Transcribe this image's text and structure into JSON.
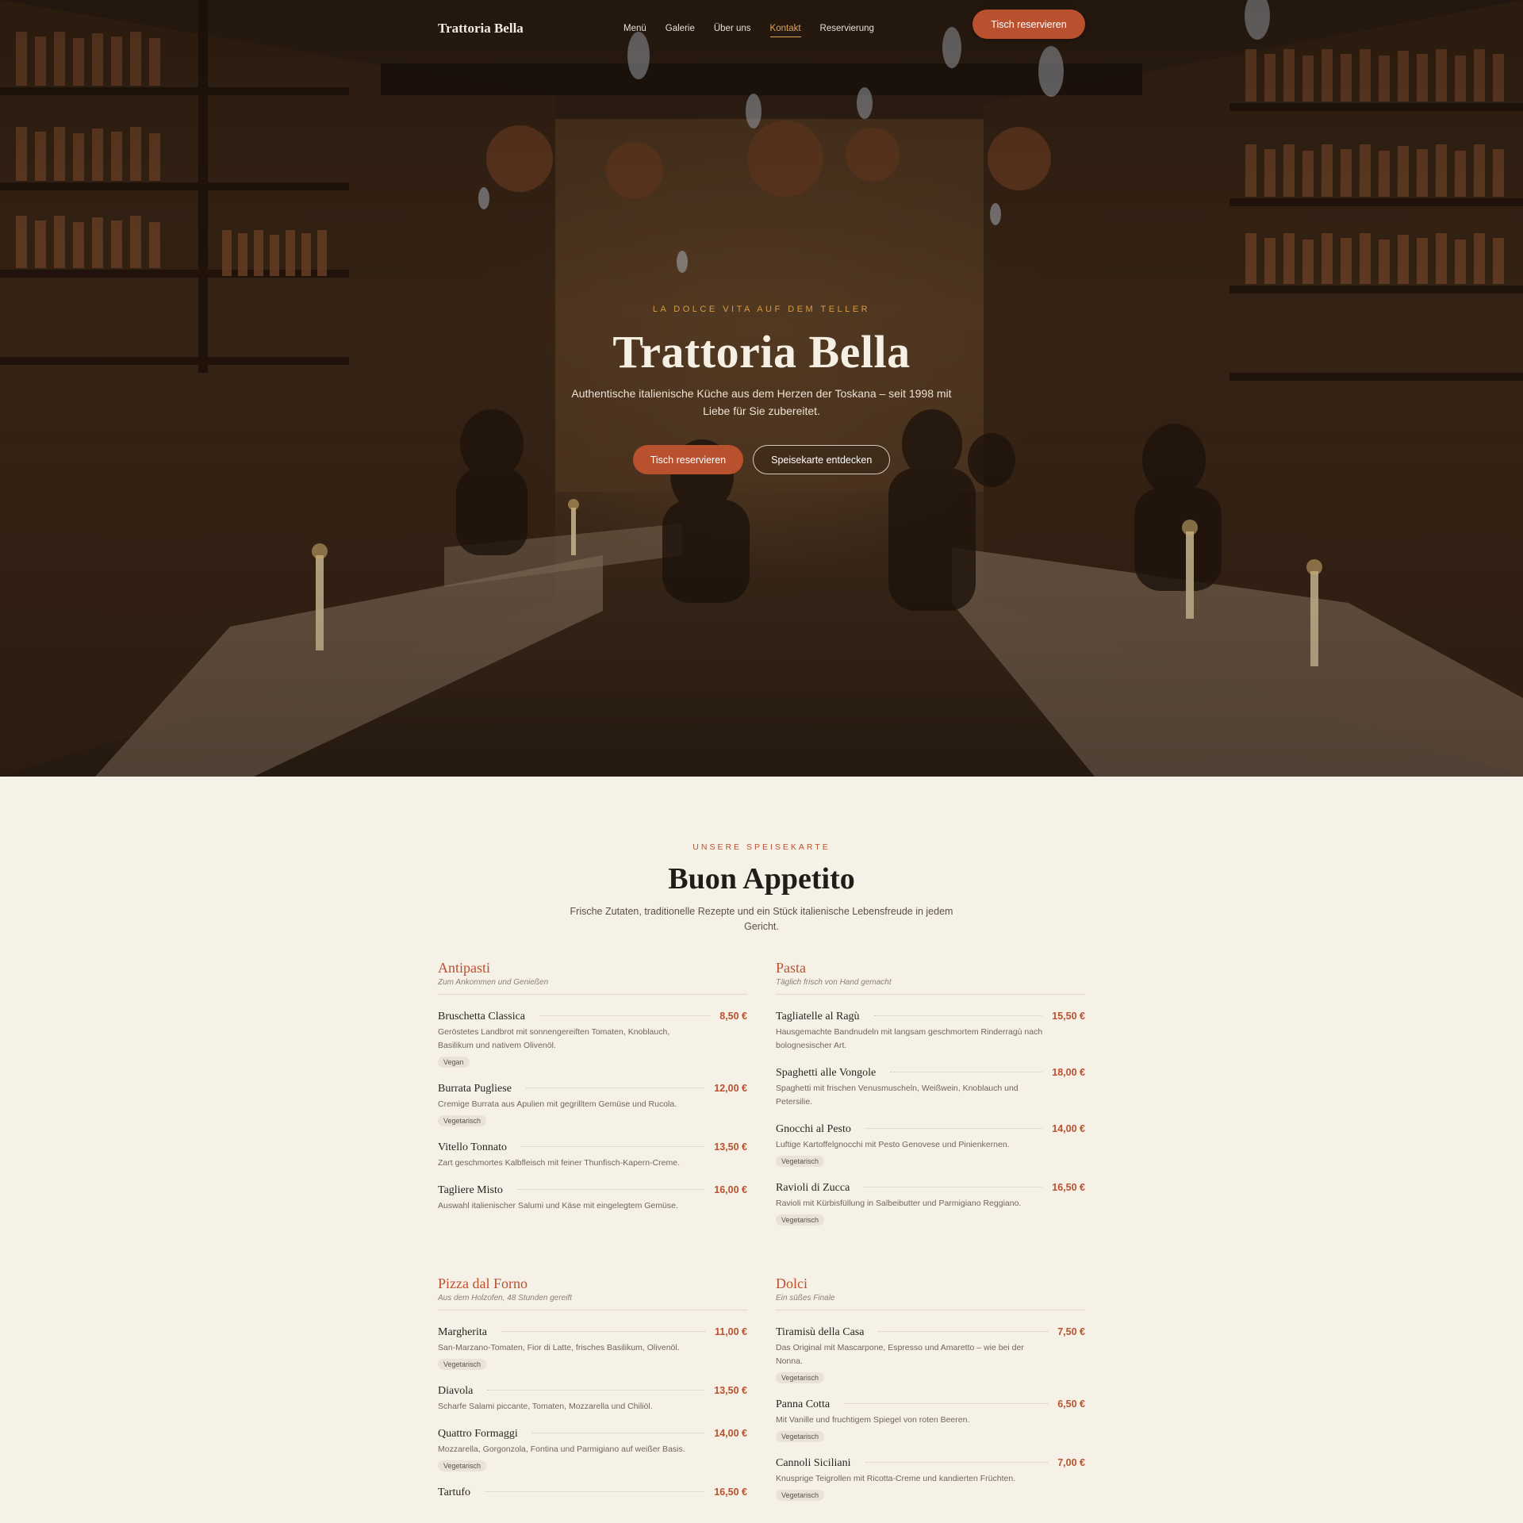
{
  "nav": {
    "brand": "Trattoria Bella",
    "links": [
      "Menü",
      "Galerie",
      "Über uns",
      "Kontakt",
      "Reservierung"
    ],
    "active_link": "Kontakt",
    "cta": "Tisch reservieren"
  },
  "hero": {
    "kicker": "LA DOLCE VITA AUF DEM TELLER",
    "title": "Trattoria Bella",
    "subtitle": "Authentische italienische Küche aus dem Herzen der Toskana – seit 1998 mit Liebe für Sie zubereitet.",
    "primary_button": "Tisch reservieren",
    "secondary_button": "Speisekarte entdecken"
  },
  "menu": {
    "kicker": "UNSERE SPEISEKARTE",
    "title": "Buon Appetito",
    "subtitle": "Frische Zutaten, traditionelle Rezepte und ein Stück italienische Lebensfreude in jedem Gericht.",
    "categories": [
      {
        "title": "Antipasti",
        "subtitle": "Zum Ankommen und Genießen",
        "items": [
          {
            "name": "Bruschetta Classica",
            "price": "8,50 €",
            "desc": "Geröstetes Landbrot mit sonnengereiften Tomaten, Knoblauch, Basilikum und nativem Olivenöl.",
            "tag": "Vegan"
          },
          {
            "name": "Burrata Pugliese",
            "price": "12,00 €",
            "desc": "Cremige Burrata aus Apulien mit gegrilltem Gemüse und Rucola.",
            "tag": "Vegetarisch"
          },
          {
            "name": "Vitello Tonnato",
            "price": "13,50 €",
            "desc": "Zart geschmortes Kalbfleisch mit feiner Thunfisch-Kapern-Creme.",
            "tag": ""
          },
          {
            "name": "Tagliere Misto",
            "price": "16,00 €",
            "desc": "Auswahl italienischer Salumi und Käse mit eingelegtem Gemüse.",
            "tag": ""
          }
        ]
      },
      {
        "title": "Pasta",
        "subtitle": "Täglich frisch von Hand gemacht",
        "items": [
          {
            "name": "Tagliatelle al Ragù",
            "price": "15,50 €",
            "desc": "Hausgemachte Bandnudeln mit langsam geschmortem Rinderragù nach bolognesischer Art.",
            "tag": ""
          },
          {
            "name": "Spaghetti alle Vongole",
            "price": "18,00 €",
            "desc": "Spaghetti mit frischen Venusmuscheln, Weißwein, Knoblauch und Petersilie.",
            "tag": ""
          },
          {
            "name": "Gnocchi al Pesto",
            "price": "14,00 €",
            "desc": "Luftige Kartoffelgnocchi mit Pesto Genovese und Pinienkernen.",
            "tag": "Vegetarisch"
          },
          {
            "name": "Ravioli di Zucca",
            "price": "16,50 €",
            "desc": "Ravioli mit Kürbisfüllung in Salbeibutter und Parmigiano Reggiano.",
            "tag": "Vegetarisch"
          }
        ]
      },
      {
        "title": "Pizza dal Forno",
        "subtitle": "Aus dem Holzofen, 48 Stunden gereift",
        "items": [
          {
            "name": "Margherita",
            "price": "11,00 €",
            "desc": "San-Marzano-Tomaten, Fior di Latte, frisches Basilikum, Olivenöl.",
            "tag": "Vegetarisch"
          },
          {
            "name": "Diavola",
            "price": "13,50 €",
            "desc": "Scharfe Salami piccante, Tomaten, Mozzarella und Chiliöl.",
            "tag": ""
          },
          {
            "name": "Quattro Formaggi",
            "price": "14,00 €",
            "desc": "Mozzarella, Gorgonzola, Fontina und Parmigiano auf weißer Basis.",
            "tag": "Vegetarisch"
          },
          {
            "name": "Tartufo",
            "price": "16,50 €",
            "desc": "",
            "tag": ""
          }
        ]
      },
      {
        "title": "Dolci",
        "subtitle": "Ein süßes Finale",
        "items": [
          {
            "name": "Tiramisù della Casa",
            "price": "7,50 €",
            "desc": "Das Original mit Mascarpone, Espresso und Amaretto – wie bei der Nonna.",
            "tag": "Vegetarisch"
          },
          {
            "name": "Panna Cotta",
            "price": "6,50 €",
            "desc": "Mit Vanille und fruchtigem Spiegel von roten Beeren.",
            "tag": "Vegetarisch"
          },
          {
            "name": "Cannoli Siciliani",
            "price": "7,00 €",
            "desc": "Knusprige Teigrollen mit Ricotta-Creme und kandierten Früchten.",
            "tag": "Vegetarisch"
          }
        ]
      }
    ]
  },
  "colors": {
    "accent": "#b9512f",
    "gold": "#d99a42",
    "background": "#f6f1e7"
  }
}
